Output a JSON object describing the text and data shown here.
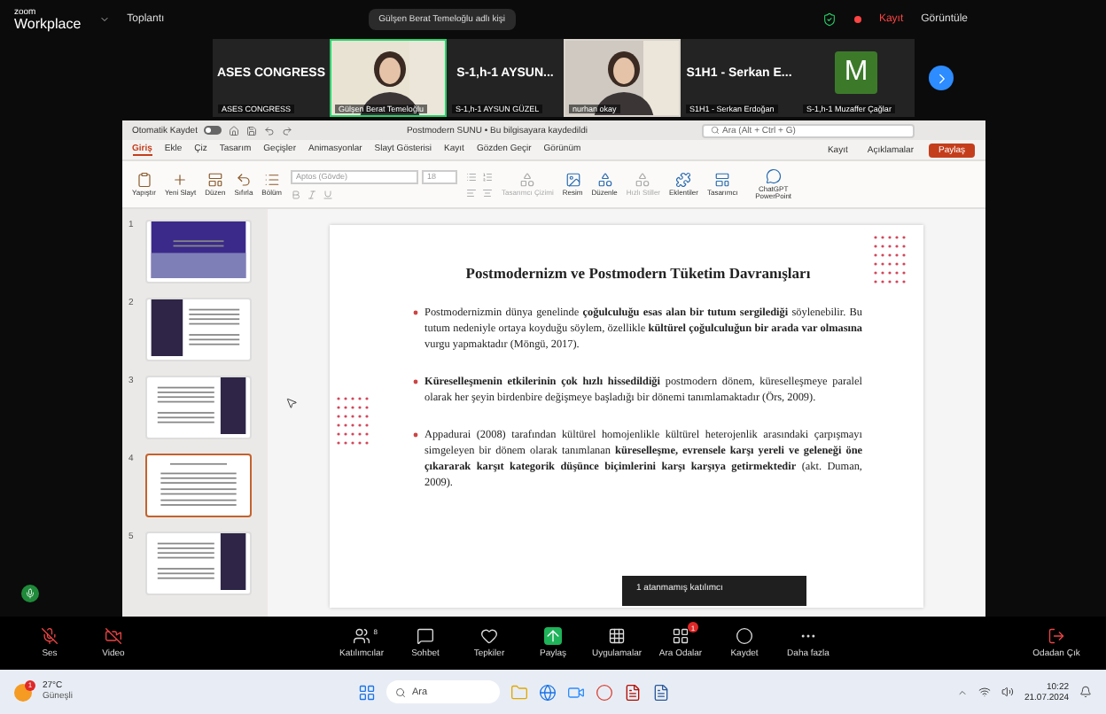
{
  "topbar": {
    "brand_small": "zoom",
    "brand": "Workplace",
    "meeting_menu": "Toplantı",
    "speaker_pill": "Gülşen Berat Temeloğlu adlı kişi",
    "record": "Kayıt",
    "view": "Görüntüle"
  },
  "participants": [
    {
      "kind": "name",
      "name": "ASES CONGRESS",
      "label": "ASES CONGRESS",
      "speaking": false
    },
    {
      "kind": "video",
      "label": "Gülşen Berat Temeloğlu",
      "speaking": true
    },
    {
      "kind": "name",
      "name": "S-1,h-1 AYSUN...",
      "label": "S-1,h-1 AYSUN GÜZEL",
      "speaking": false
    },
    {
      "kind": "video",
      "label": "nurhan okay",
      "speaking": false
    },
    {
      "kind": "name",
      "name": "S1H1 - Serkan E...",
      "label": "S1H1 - Serkan Erdoğan",
      "speaking": false
    },
    {
      "kind": "avatar",
      "name": "M",
      "label": "S-1,h-1 Muzaffer Çağlar",
      "speaking": false
    }
  ],
  "ppt": {
    "autosave": "Otomatik Kaydet",
    "autosave_on": false,
    "title": "Postmodern SUNU • Bu bilgisayara kaydedildi",
    "search": "Ara (Alt + Ctrl + G)",
    "tabs": [
      {
        "label": "Giriş",
        "selected": true
      },
      {
        "label": "Ekle",
        "selected": false
      },
      {
        "label": "Çiz",
        "selected": false
      },
      {
        "label": "Tasarım",
        "selected": false
      },
      {
        "label": "Geçişler",
        "selected": false
      },
      {
        "label": "Animasyonlar",
        "selected": false
      },
      {
        "label": "Slayt Gösterisi",
        "selected": false
      },
      {
        "label": "Kayıt",
        "selected": false
      },
      {
        "label": "Gözden Geçir",
        "selected": false
      },
      {
        "label": "Görünüm",
        "selected": false
      }
    ],
    "record": "Kayıt",
    "comments": "Açıklamalar",
    "share": "Paylaş",
    "font": "Aptos (Gövde)",
    "font_size": "18",
    "ribbon": [
      {
        "label": "Yapıştır",
        "disabled": false
      },
      {
        "label": "Yeni Slayt",
        "disabled": false
      },
      {
        "label": "Düzen",
        "disabled": false
      },
      {
        "label": "Sıfırla",
        "disabled": false
      },
      {
        "label": "Bölüm",
        "disabled": false
      },
      {
        "label": "Tasarımcı Çizimi",
        "disabled": true
      },
      {
        "label": "Resim",
        "disabled": false
      },
      {
        "label": "Düzenle",
        "disabled": false
      },
      {
        "label": "Hızlı Stiller",
        "disabled": true
      },
      {
        "label": "Eklentiler",
        "disabled": false
      },
      {
        "label": "Tasarımcı",
        "disabled": false
      },
      {
        "label": "ChatGPT PowerPoint",
        "disabled": false
      }
    ],
    "thumbnails": [
      {
        "number": "1",
        "kind": "title",
        "selected": false
      },
      {
        "number": "2",
        "kind": "left-bar",
        "selected": false
      },
      {
        "number": "3",
        "kind": "right-bar",
        "selected": false
      },
      {
        "number": "4",
        "kind": "text",
        "selected": true
      },
      {
        "number": "5",
        "kind": "right-bar",
        "selected": false
      }
    ],
    "slide": {
      "title": "Postmodernizm ve Postmodern Tüketim Davranışları",
      "bullets": [
        "Postmodernizmin dünya genelinde **çoğulculuğu esas alan bir tutum sergilediği** söylenebilir. Bu tutum nedeniyle ortaya koyduğu söylem, özellikle **kültürel çoğulculuğun bir arada var olmasına** vurgu yapmaktadır (Möngü, 2017).",
        "**Küreselleşmenin etkilerinin çok hızlı hissedildiği** postmodern dönem, küreselleşmeye paralel olarak her şeyin birdenbire değişmeye başladığı bir dönemi tanımlamaktadır (Örs, 2009).",
        "Appadurai (2008) tarafından kültürel homojenlikle kültürel heterojenlik arasındaki çarpışmayı simgeleyen bir dönem olarak tanımlanan **küreselleşme, evrensele karşı yereli ve geleneği öne çıkararak karşıt kategorik düşünce biçimlerini karşı karşıya getirmektedir** (akt. Duman, 2009)."
      ]
    }
  },
  "tooltip": "1 atanmamış katılımcı",
  "toolbar": [
    {
      "label": "Ses",
      "muted": true
    },
    {
      "label": "Video",
      "muted": true
    },
    {
      "label": "Katılımcılar",
      "count": "8"
    },
    {
      "label": "Sohbet"
    },
    {
      "label": "Tepkiler"
    },
    {
      "label": "Paylaş"
    },
    {
      "label": "Uygulamalar"
    },
    {
      "label": "Ara Odalar",
      "badge": "1"
    },
    {
      "label": "Kaydet"
    },
    {
      "label": "Daha fazla"
    }
  ],
  "leave": "Odadan Çık",
  "taskbar": {
    "weather_badge": "1",
    "temperature": "27°C",
    "weather": "Güneşli",
    "search": "Ara",
    "time": "10:22",
    "date": "21.07.2024"
  }
}
